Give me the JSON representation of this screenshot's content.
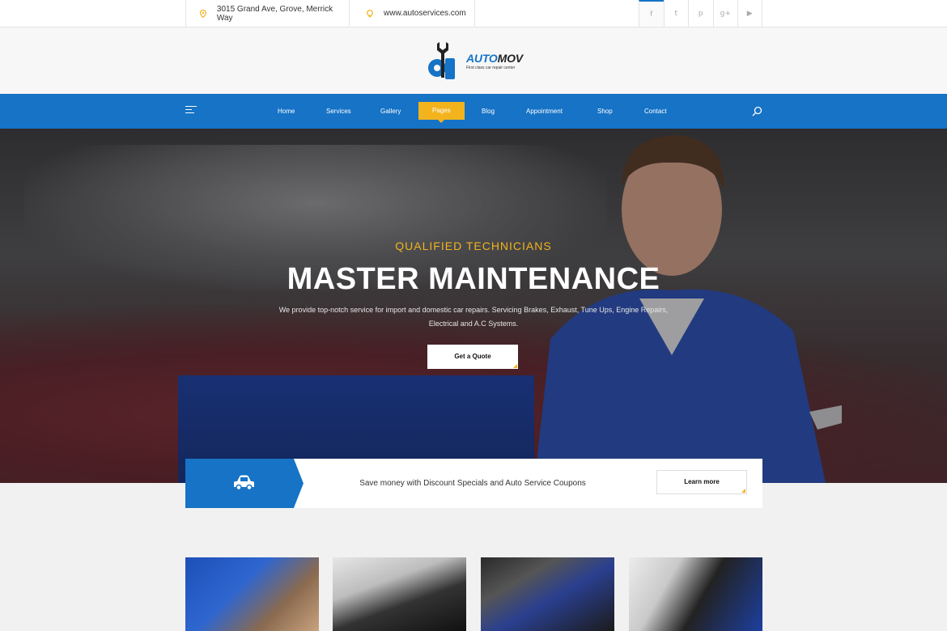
{
  "topbar": {
    "address": "3015 Grand Ave, Grove, Merrick Way",
    "website": "www.autoservices.com",
    "social": [
      {
        "icon": "facebook-icon",
        "glyph": "f"
      },
      {
        "icon": "twitter-icon",
        "glyph": "t"
      },
      {
        "icon": "pinterest-icon",
        "glyph": "p"
      },
      {
        "icon": "google-plus-icon",
        "glyph": "g+"
      },
      {
        "icon": "youtube-icon",
        "glyph": "▶"
      }
    ]
  },
  "logo": {
    "name_part1": "AUTO",
    "name_part2": "MOV",
    "tagline": "First class car repair center"
  },
  "nav": {
    "items": [
      "Home",
      "Services",
      "Gallery",
      "Pages",
      "Blog",
      "Appointment",
      "Shop",
      "Contact"
    ],
    "active": "Pages"
  },
  "hero": {
    "kicker": "QUALIFIED TECHNICIANS",
    "title": "MASTER MAINTENANCE",
    "description": "We provide top-notch service for import and domestic car repairs. Servicing Brakes, Exhaust, Tune Ups, Engine Repairs, Electrical and A.C Systems.",
    "cta": "Get a Quote"
  },
  "promo": {
    "icon": "car-icon",
    "text": "Save money with Discount Specials and Auto Service Coupons",
    "button": "Learn more"
  },
  "colors": {
    "primary": "#1673c6",
    "accent": "#f2b31c"
  }
}
